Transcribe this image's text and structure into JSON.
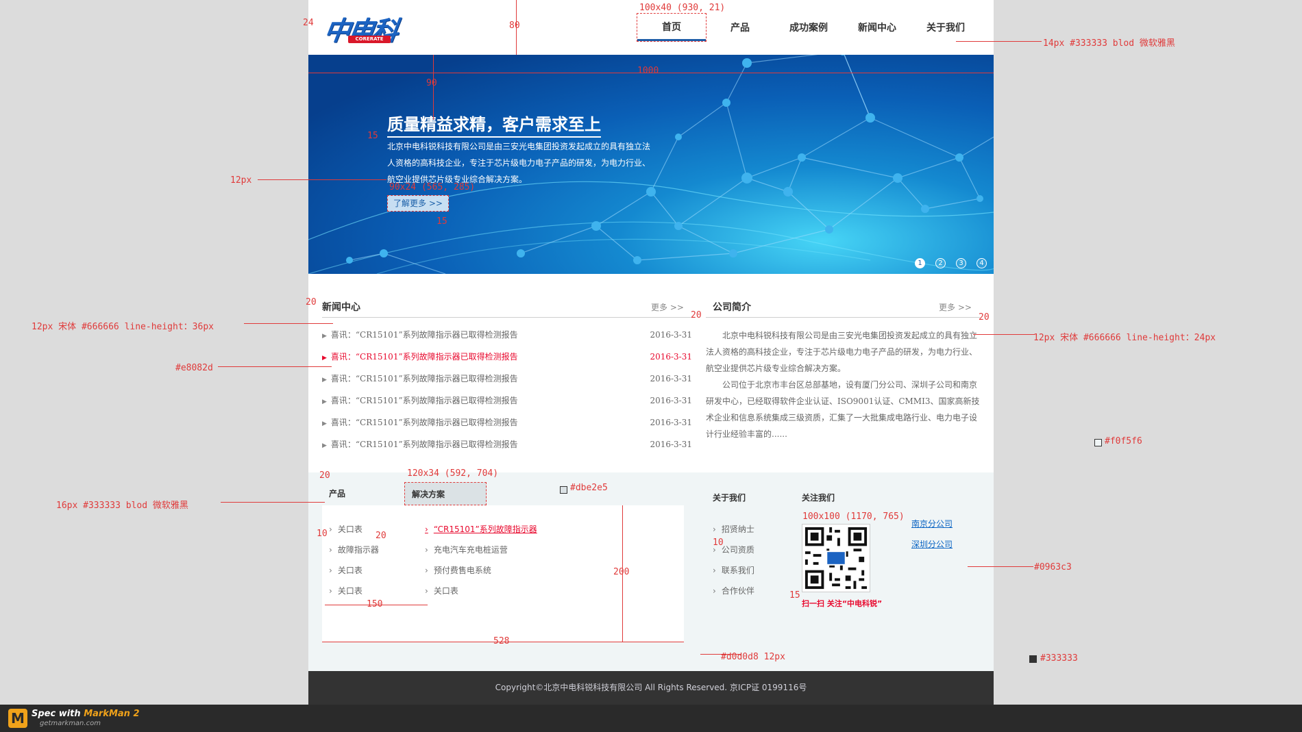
{
  "header": {
    "logo_text": "中电科锐",
    "logo_tag": "CORERATE",
    "nav": [
      "首页",
      "产品",
      "成功案例",
      "新闻中心",
      "关于我们"
    ]
  },
  "banner": {
    "title": "质量精益求精，客户需求至上",
    "desc": "北京中电科锐科技有限公司是由三安光电集团投资发起成立的具有独立法人资格的高科技企业，专注于芯片级电力电子产品的研发，为电力行业、航空业提供芯片级专业综合解决方案。",
    "more": "了解更多 >>",
    "dots": [
      "1",
      "2",
      "3",
      "4"
    ]
  },
  "news": {
    "title": "新闻中心",
    "more": "更多 >>",
    "items": [
      {
        "text": "喜讯：“CR15101”系列故障指示器已取得检测报告",
        "date": "2016-3-31"
      },
      {
        "text": "喜讯：“CR15101”系列故障指示器已取得检测报告",
        "date": "2016-3-31"
      },
      {
        "text": "喜讯：“CR15101”系列故障指示器已取得检测报告",
        "date": "2016-3-31"
      },
      {
        "text": "喜讯：“CR15101”系列故障指示器已取得检测报告",
        "date": "2016-3-31"
      },
      {
        "text": "喜讯：“CR15101”系列故障指示器已取得检测报告",
        "date": "2016-3-31"
      },
      {
        "text": "喜讯：“CR15101”系列故障指示器已取得检测报告",
        "date": "2016-3-31"
      }
    ]
  },
  "intro": {
    "title": "公司简介",
    "more": "更多 >>",
    "p1": "北京中电科锐科技有限公司是由三安光电集团投资发起成立的具有独立法人资格的高科技企业，专注于芯片级电力电子产品的研发，为电力行业、航空业提供芯片级专业综合解决方案。",
    "p2": "公司位于北京市丰台区总部基地，设有厦门分公司、深圳子公司和南京研发中心，已经取得软件企业认证、ISO9001认证、CMMI3、国家高新技术企业和信息系统集成三级资质，汇集了一大批集成电路行业、电力电子设计行业经验丰富的......"
  },
  "products": {
    "tab1": "产品",
    "tab2": "解决方案",
    "col1": [
      "关口表",
      "故障指示器",
      "关口表",
      "关口表"
    ],
    "col2": [
      "“CR15101”系列故障指示器",
      "充电汽车充电桩运营",
      "预付费售电系统",
      "关口表"
    ]
  },
  "about": {
    "title": "关于我们",
    "items": [
      "招贤纳士",
      "公司资质",
      "联系我们",
      "合作伙伴"
    ]
  },
  "follow": {
    "title": "关注我们",
    "caption": "扫一扫 关注“中电科锐”",
    "branches": [
      "南京分公司",
      "深圳分公司"
    ]
  },
  "footer": {
    "copyright": "Copyright©北京中电科锐科技有限公司 All Rights Reserved. 京ICP证 0199116号"
  },
  "annotations": {
    "logo_gap": "24",
    "header_h": "80",
    "nav_spec": "100x40 (930, 21)",
    "nav_font": "14px  #333333  blod  微软雅黑",
    "banner_w": "1000",
    "banner_gap": "90",
    "line15a": "15",
    "line12": "12px",
    "btn_spec": "90x24 (565, 285)",
    "line15b": "15",
    "news_gap": "20",
    "mid_gap": "20",
    "right_gap": "20",
    "news_font": "12px  宋体  #666666  line-height：36px",
    "red_color": "#e8082d",
    "intro_font": "12px  宋体  #666666   line-height：24px",
    "bg_color": "#f0f5f6",
    "tab_gap": "20",
    "tab_spec": "120x34 (592, 704)",
    "tab_color": "#dbe2e5",
    "tab_font": "16px  #333333  blod  微软雅黑",
    "li_gap": "10",
    "col_gap": "20",
    "col_w": "150",
    "panel_h": "200",
    "panel_w": "528",
    "qr_spec": "100x100 (1170, 765)",
    "qr_gap": "15",
    "about_gap": "10",
    "link_color": "#0963c3",
    "footer_font": "#d0d0d8  12px",
    "footer_color": "#333333"
  },
  "markman": {
    "line1_a": "Spec with ",
    "line1_b": "MarkMan 2",
    "line2": "getmarkman.com"
  },
  "colors": {
    "accent": "#1f5ea8",
    "hot": "#e8082d",
    "link": "#0963c3",
    "lower_bg": "#f0f5f6",
    "tab_bg": "#dbe2e5",
    "footer_bg": "#333333"
  }
}
